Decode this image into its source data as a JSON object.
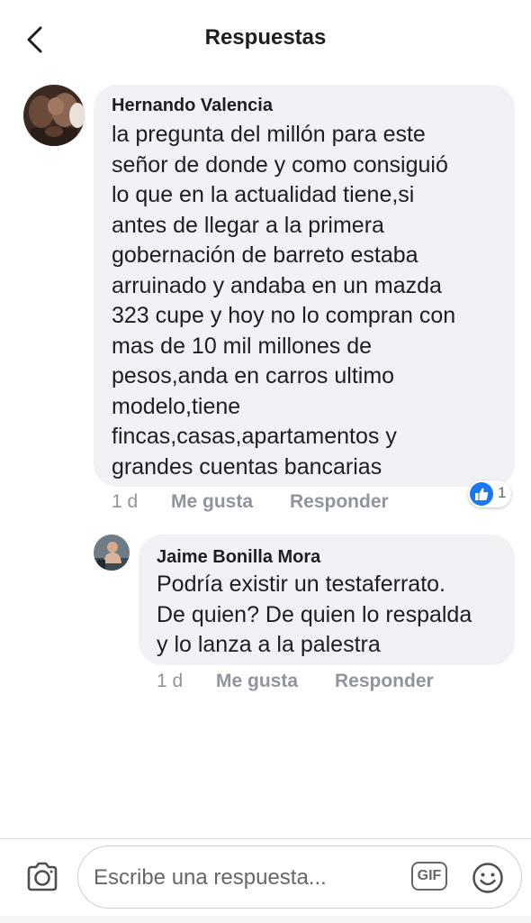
{
  "header": {
    "title": "Respuestas",
    "back_icon": "chevron-left-icon"
  },
  "comments": [
    {
      "author": "Hernando Valencia",
      "avatar": "profile-photo-dogs",
      "text": "la pregunta del millón para este\nseñor de donde  y como consiguió\nlo que en la actualidad tiene,si\nantes de llegar a la primera\ngobernación de barreto estaba\narruinado y andaba en un mazda\n323 cupe y hoy no lo compran con\nmas de 10 mil millones de\npesos,anda en carros ultimo\nmodelo,tiene\nfincas,casas,apartamentos y\ngrandes cuentas bancarias",
      "time": "1 d",
      "like_label": "Me gusta",
      "reply_label": "Responder",
      "reaction_icon": "like-icon",
      "reaction_count": "1"
    },
    {
      "author": "Jaime Bonilla Mora",
      "avatar": "profile-photo-man",
      "text": "Podría existir un testaferrato.\nDe quien? De quien lo respalda\ny lo lanza a la palestra",
      "time": "1 d",
      "like_label": "Me gusta",
      "reply_label": "Responder"
    }
  ],
  "composer": {
    "placeholder": "Escribe una respuesta...",
    "gif_label": "GIF",
    "camera_icon": "camera-icon",
    "emoji_icon": "emoji-icon"
  },
  "colors": {
    "bubble": "#f0f2f5",
    "meta": "#90949c",
    "like_blue": "#1877f2",
    "text": "#1c1e21"
  }
}
